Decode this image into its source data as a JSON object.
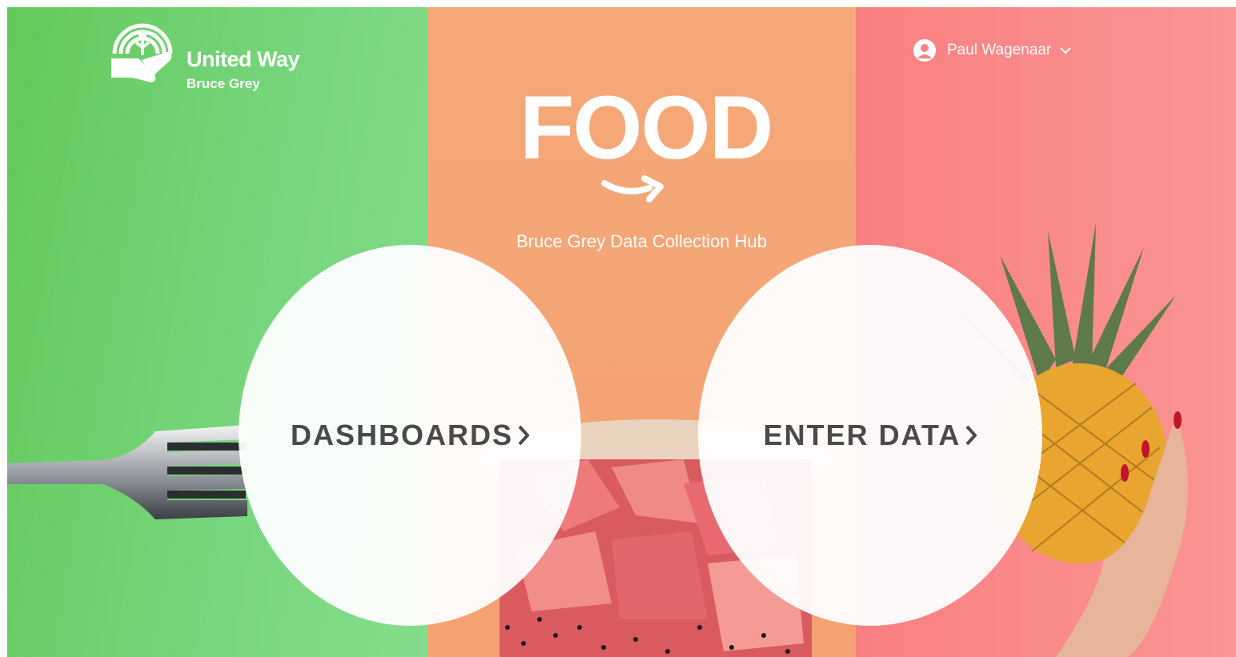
{
  "brand": {
    "name": "United Way",
    "region": "Bruce Grey"
  },
  "user": {
    "name": "Paul Wagenaar"
  },
  "hero": {
    "title": "FOOD",
    "subtitle": "Bruce Grey Data Collection Hub"
  },
  "actions": {
    "dashboards_label": "DASHBOARDS",
    "enter_data_label": "ENTER DATA"
  },
  "colors": {
    "left_panel": "#6fd07a",
    "center_panel": "#f5a676",
    "right_panel": "#fa8a8a",
    "button_text": "#4a4a4a"
  },
  "icons": {
    "logo": "united-way-hand-icon",
    "avatar": "user-avatar-icon",
    "menu": "chevron-down-icon",
    "arrow": "chevron-right-icon"
  }
}
